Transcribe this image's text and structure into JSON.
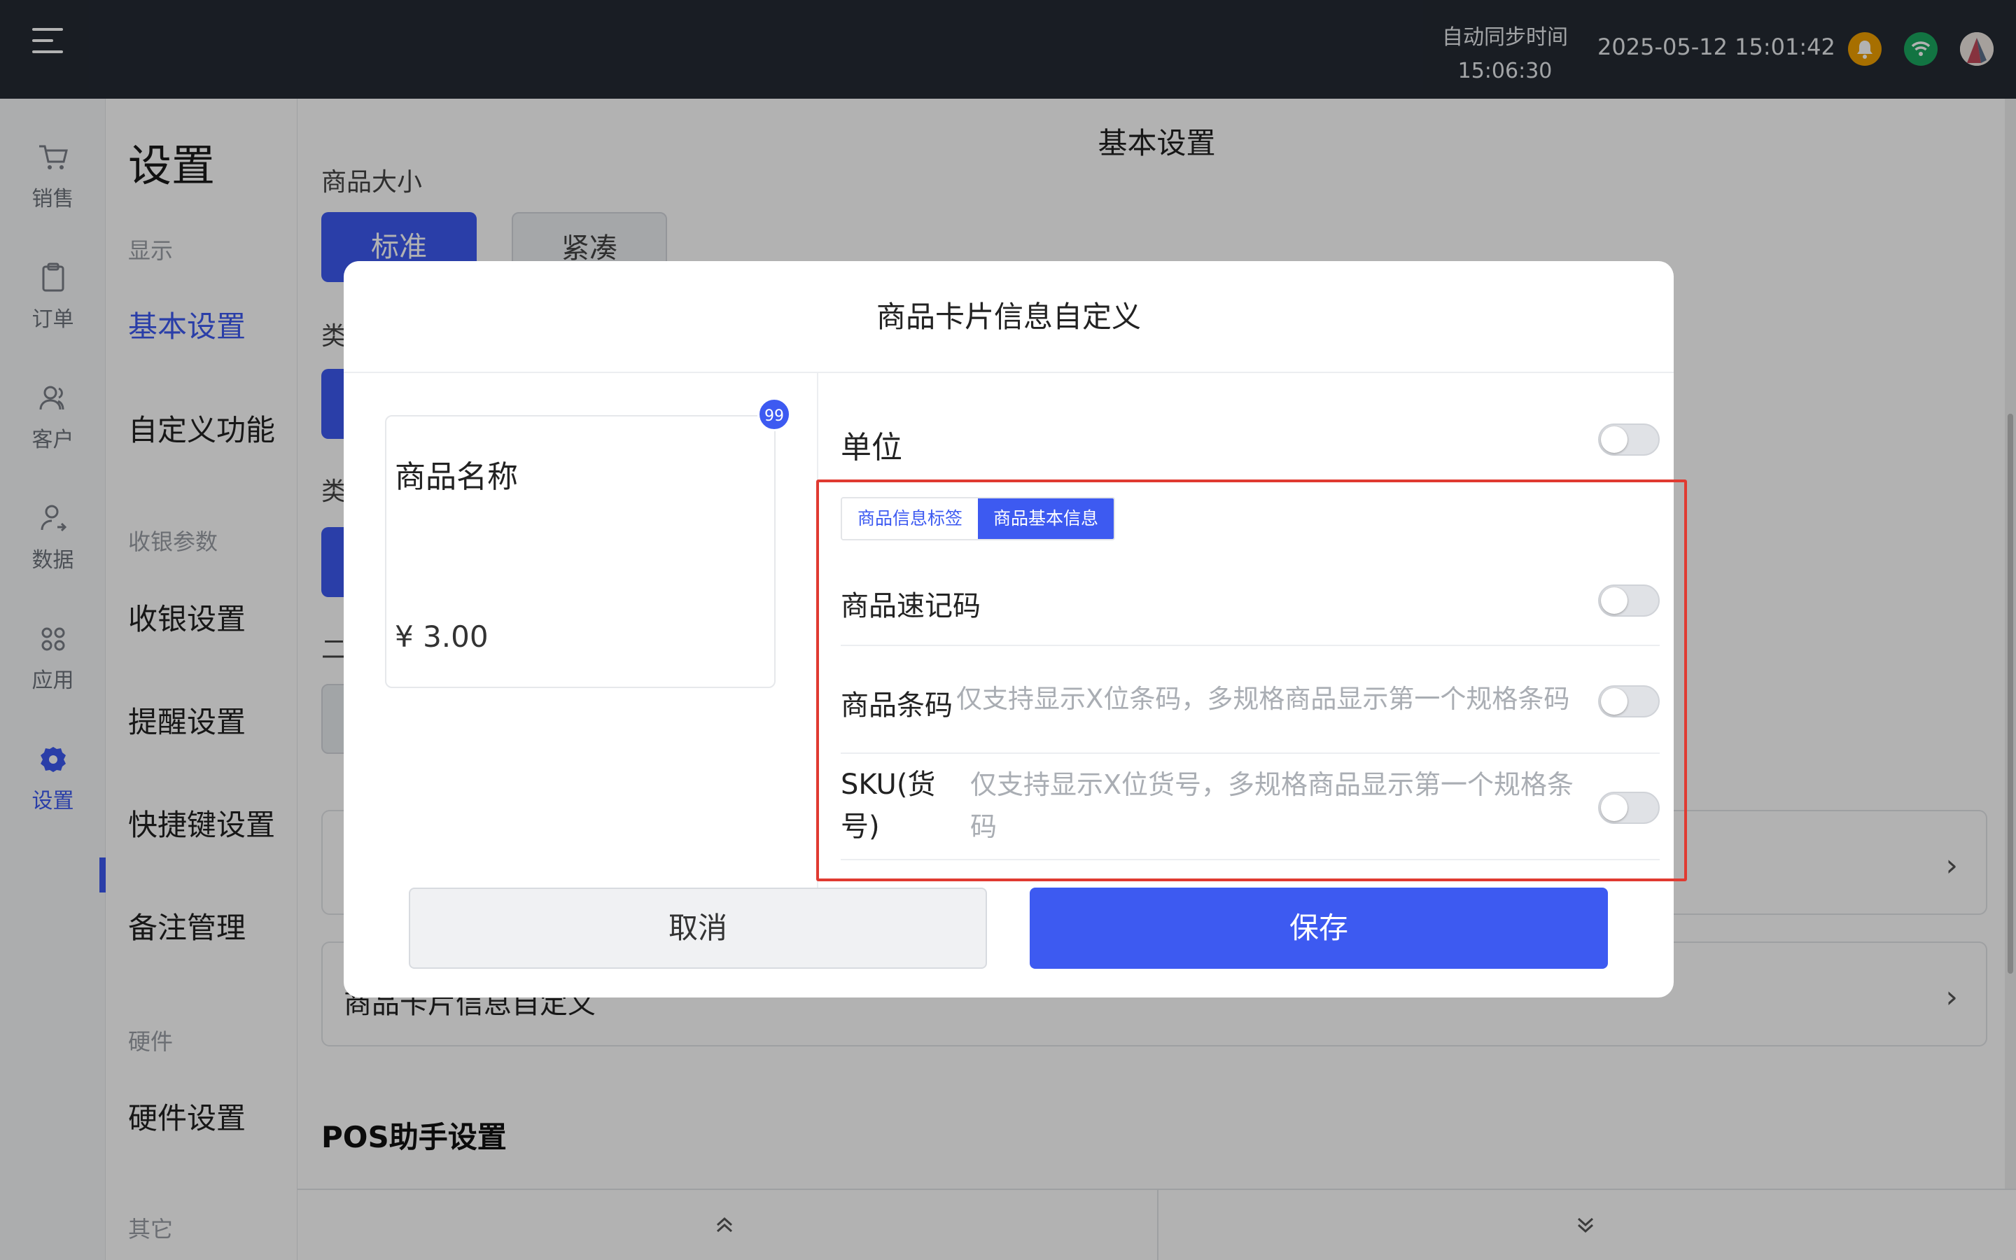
{
  "topbar": {
    "sync_label": "自动同步时间",
    "sync_time": "15:06:30",
    "datetime": "2025-05-12 15:01:42",
    "icons": [
      "menu-icon",
      "bell-icon",
      "wifi-icon",
      "avatar"
    ]
  },
  "rail": {
    "items": [
      {
        "label": "销售",
        "icon": "cart-icon"
      },
      {
        "label": "订单",
        "icon": "clipboard-icon"
      },
      {
        "label": "客户",
        "icon": "users-icon"
      },
      {
        "label": "数据",
        "icon": "user-data-icon"
      },
      {
        "label": "应用",
        "icon": "apps-icon"
      },
      {
        "label": "设置",
        "icon": "gear-icon"
      }
    ],
    "active": "设置"
  },
  "settings_nav": {
    "title": "设置",
    "sections": {
      "display": "显示",
      "cashier_params": "收银参数",
      "hardware": "硬件",
      "other": "其它"
    },
    "items": {
      "basic": "基本设置",
      "custom": "自定义功能",
      "cashier": "收银设置",
      "reminder": "提醒设置",
      "shortcut": "快捷键设置",
      "remark": "备注管理",
      "hardware": "硬件设置"
    },
    "active": "基本设置"
  },
  "content": {
    "title": "基本设置",
    "clipped_label": "商品大小",
    "size_options": {
      "standard": "标准",
      "compact": "紧凑"
    },
    "side_labels": {
      "a": "类",
      "b": "类",
      "c": "二"
    },
    "card_row_label": "商品卡片信息自定义",
    "pos_section": "POS助手设置"
  },
  "modal": {
    "title": "商品卡片信息自定义",
    "preview": {
      "name": "商品名称",
      "price": "¥ 3.00",
      "badge": "99"
    },
    "unit_label": "单位",
    "tabs": [
      "商品信息标签",
      "商品基本信息"
    ],
    "active_tab": "商品基本信息",
    "options": [
      {
        "label": "商品速记码",
        "hint": "",
        "enabled": false
      },
      {
        "label": "商品条码",
        "hint": "仅支持显示X位条码，多规格商品显示第一个规格条码",
        "enabled": false
      },
      {
        "label": "SKU(货号)",
        "hint": "仅支持显示X位货号，多规格商品显示第一个规格条码",
        "enabled": false
      }
    ],
    "unit_enabled": false,
    "cancel": "取消",
    "save": "保存"
  },
  "colors": {
    "accent": "#3d5af1",
    "highlight": "#e03a31",
    "topbar": "#242a33"
  }
}
